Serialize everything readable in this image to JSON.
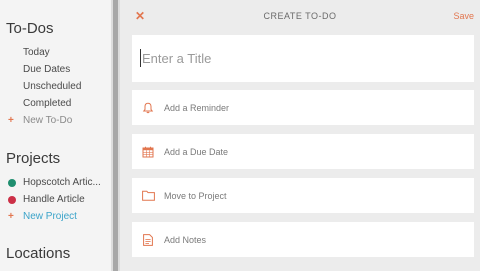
{
  "sidebar": {
    "todos_title": "To-Dos",
    "todo_items": [
      "Today",
      "Due Dates",
      "Unscheduled",
      "Completed"
    ],
    "new_todo_label": "New To-Do",
    "projects_title": "Projects",
    "projects": [
      {
        "name": "Hopscotch Artic...",
        "color": "#1f8e6f"
      },
      {
        "name": "Handle Article",
        "color": "#cc3047"
      }
    ],
    "new_project_label": "New Project",
    "locations_title": "Locations"
  },
  "dialog": {
    "close_glyph": "✕",
    "title": "CREATE TO-DO",
    "save_label": "Save",
    "title_placeholder": "Enter a Title",
    "fields": [
      {
        "label": "Add a Reminder",
        "icon": "bell-icon"
      },
      {
        "label": "Add a Due Date",
        "icon": "calendar-icon"
      },
      {
        "label": "Move to Project",
        "icon": "folder-icon"
      },
      {
        "label": "Add Notes",
        "icon": "notes-icon"
      }
    ]
  },
  "colors": {
    "accent": "#e2764f",
    "link": "#3aa3c9"
  }
}
